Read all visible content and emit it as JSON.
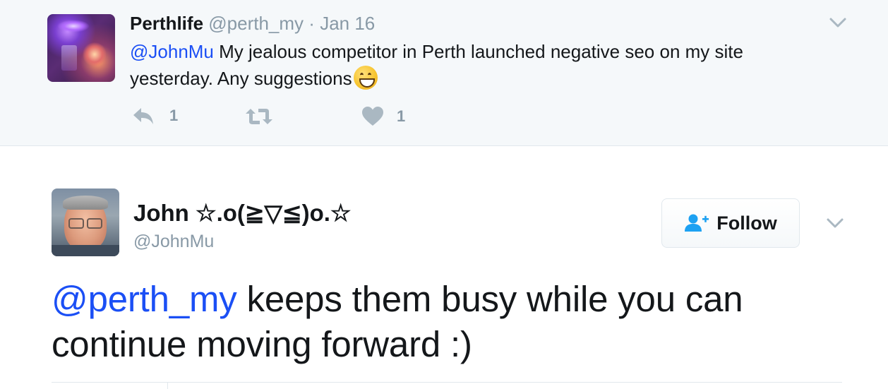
{
  "parent_tweet": {
    "display_name": "Perthlife",
    "handle": "@perth_my",
    "separator": "·",
    "date": "Jan 16",
    "mention": "@JohnMu",
    "text": " My jealous competitor in Perth launched negative seo on my site yesterday. Any suggestions",
    "emoji": "grinning-face-with-smiling-eyes",
    "reply_count": "1",
    "like_count": "1"
  },
  "main_tweet": {
    "display_name": "John ☆.o(≧▽≦)o.☆",
    "handle": "@JohnMu",
    "follow_label": "Follow",
    "mention": "@perth_my",
    "text": " keeps them busy while you can continue moving forward :)"
  },
  "colors": {
    "link": "#1b4ff5",
    "muted": "#8899a6",
    "parent_background": "#f5f8fa",
    "follow_icon": "#1da1f2"
  },
  "icons": [
    "reply-icon",
    "retweet-icon",
    "heart-icon",
    "chevron-down-icon",
    "follow-user-icon"
  ]
}
